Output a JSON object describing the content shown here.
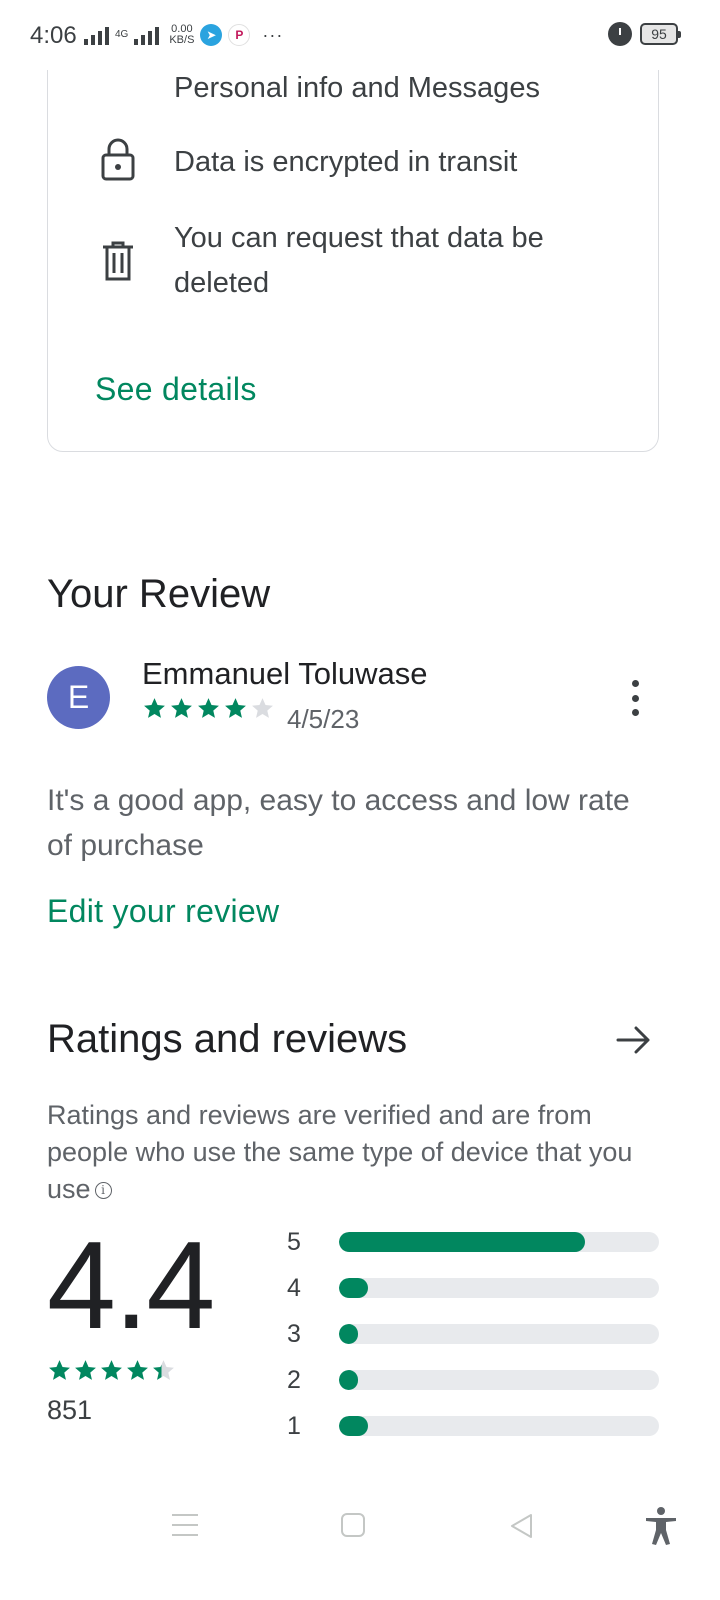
{
  "status_bar": {
    "time": "4:06",
    "network_type": "4G",
    "speed_value": "0.00",
    "speed_unit": "KB/S",
    "battery": "95"
  },
  "data_safety": {
    "items": [
      {
        "icon": "share-icon",
        "text": "Personal info and Messages"
      },
      {
        "icon": "lock-icon",
        "text": "Data is encrypted in transit"
      },
      {
        "icon": "trash-icon",
        "text": "You can request that data be deleted"
      }
    ],
    "link": "See details"
  },
  "your_review": {
    "heading": "Your Review",
    "avatar_initial": "E",
    "avatar_color": "#5c6bc0",
    "author": "Emmanuel Toluwase",
    "rating": 4,
    "date": "4/5/23",
    "text": "It's a good app, easy to access and low rate of purchase",
    "edit_label": "Edit your review"
  },
  "ratings": {
    "heading": "Ratings and reviews",
    "verified_note": "Ratings and reviews are verified and are from people who use the same type of device that you use",
    "score": "4.4",
    "score_stars": 4.4,
    "review_count": "851",
    "distribution": [
      {
        "stars": "5",
        "fraction": 0.77
      },
      {
        "stars": "4",
        "fraction": 0.09
      },
      {
        "stars": "3",
        "fraction": 0.06
      },
      {
        "stars": "2",
        "fraction": 0.06
      },
      {
        "stars": "1",
        "fraction": 0.09
      }
    ]
  },
  "colors": {
    "accent": "#01875f",
    "track": "#e8eaed",
    "star_empty": "#dadce0"
  }
}
